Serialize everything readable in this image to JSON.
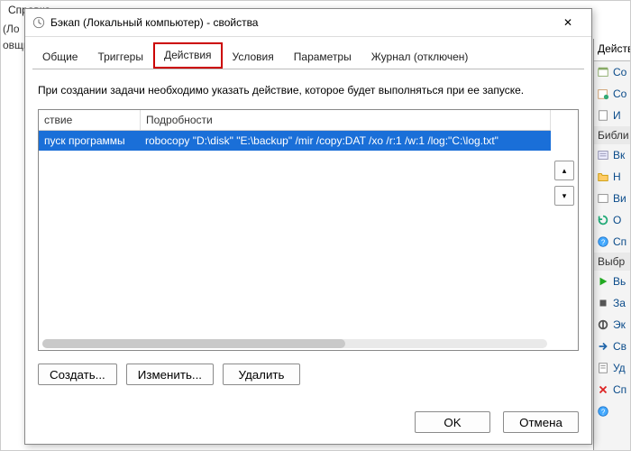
{
  "bg": {
    "menu_help": "Справка",
    "left_line1": "(Ло",
    "left_line2": "овщи"
  },
  "side": {
    "header": "Действ",
    "items": [
      {
        "label": "Со"
      },
      {
        "label": "Со"
      },
      {
        "label": "И"
      }
    ],
    "sub1": "Библи",
    "items2": [
      {
        "label": "Вк"
      },
      {
        "label": "Н"
      },
      {
        "label": "Ви"
      },
      {
        "label": "О"
      },
      {
        "label": "Сп"
      }
    ],
    "sub2": "Выбр",
    "items3": [
      {
        "label": "Вь"
      },
      {
        "label": "За"
      },
      {
        "label": "Эк"
      },
      {
        "label": "Св"
      },
      {
        "label": "Уд"
      },
      {
        "label": "Сп"
      }
    ]
  },
  "dialog": {
    "title": "Бэкап (Локальный компьютер) - свойства",
    "tabs": {
      "general": "Общие",
      "triggers": "Триггеры",
      "actions": "Действия",
      "conditions": "Условия",
      "settings": "Параметры",
      "history": "Журнал (отключен)"
    },
    "desc": "При создании задачи необходимо указать действие, которое будет выполняться при ее запуске.",
    "list": {
      "col_action": "ствие",
      "col_details": "Подробности",
      "row1_action": "пуск программы",
      "row1_details": "robocopy \"D:\\disk\" \"E:\\backup\" /mir /copy:DAT /xo /r:1 /w:1 /log:\"C:\\log.txt\""
    },
    "btn_new": "Создать...",
    "btn_edit": "Изменить...",
    "btn_delete": "Удалить",
    "btn_ok": "OK",
    "btn_cancel": "Отмена",
    "arrow_up": "▴",
    "arrow_down": "▾",
    "close_x": "✕"
  }
}
